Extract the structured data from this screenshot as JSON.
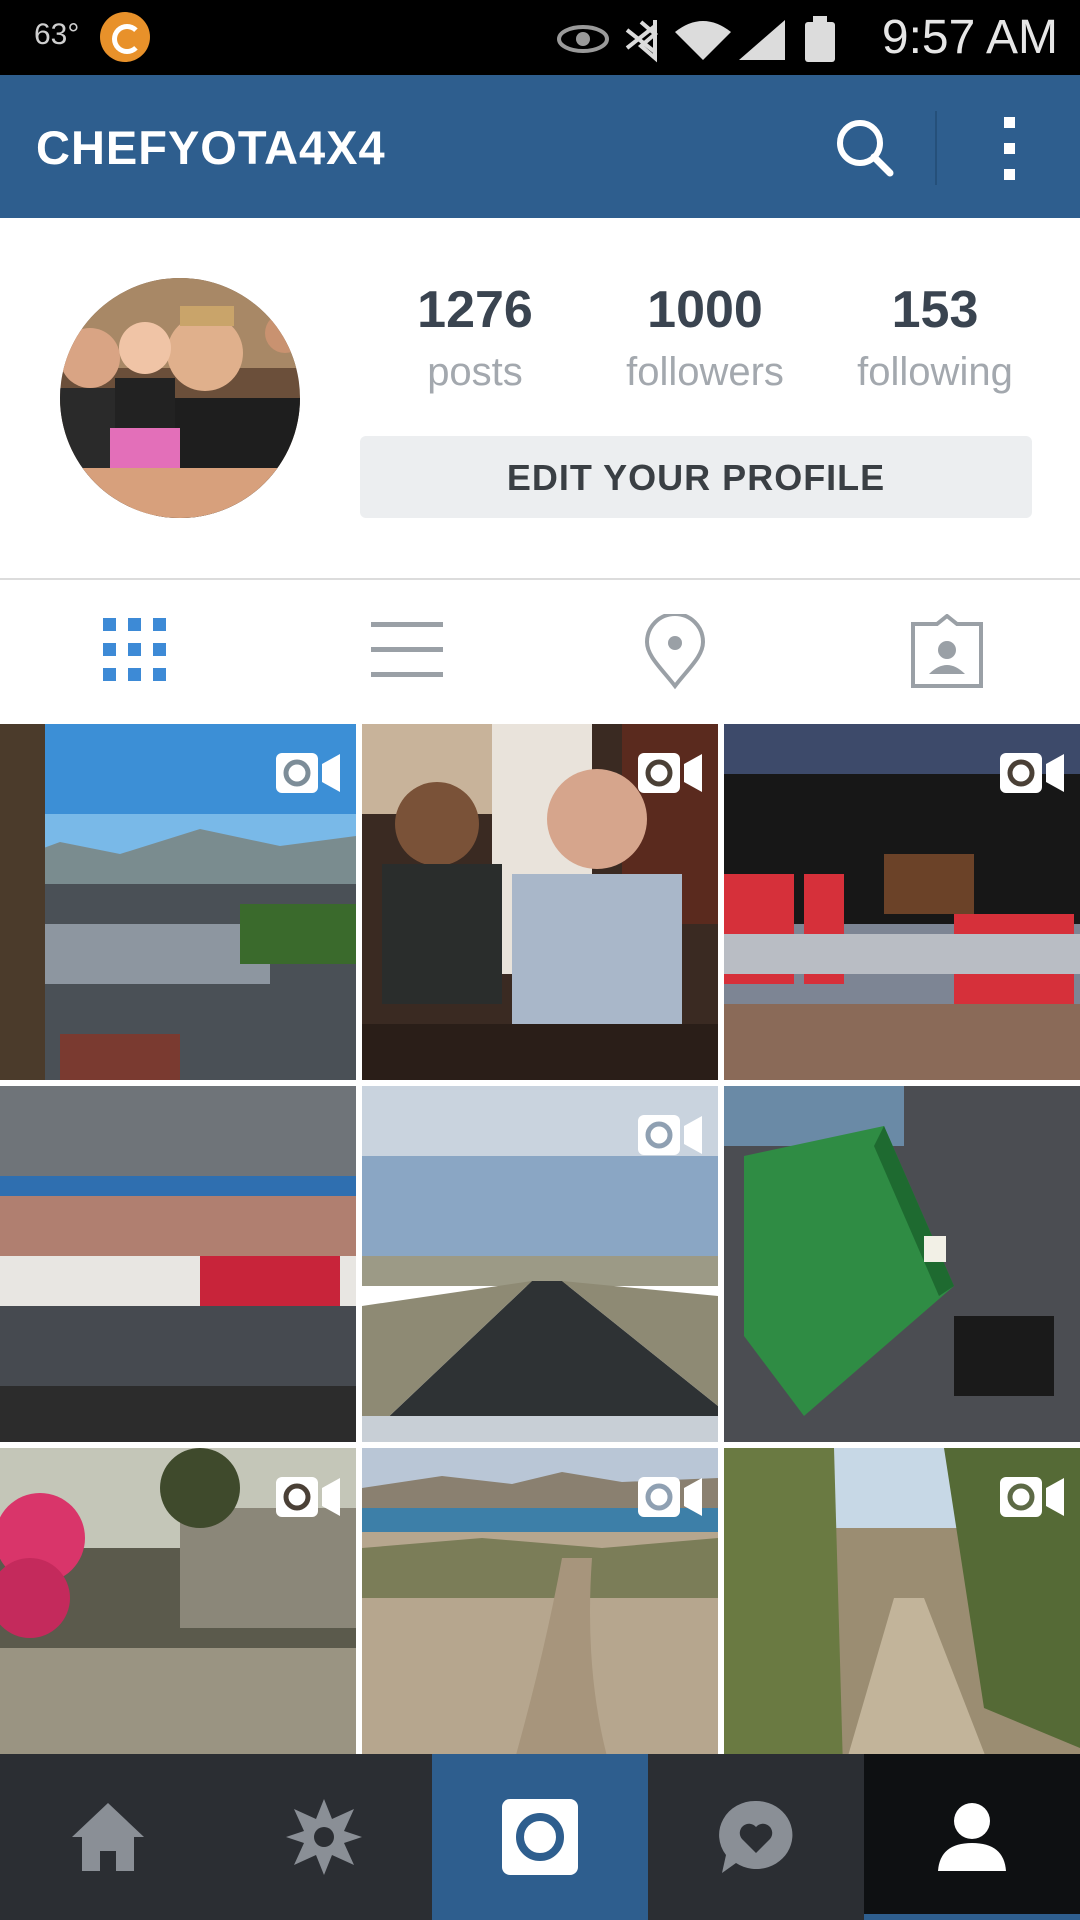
{
  "status_bar": {
    "temperature": "63°",
    "time": "9:57 AM",
    "icons": [
      "weather-icon",
      "app-notification-icon",
      "eye-icon",
      "bluetooth-icon",
      "wifi-icon",
      "signal-icon",
      "battery-icon"
    ]
  },
  "app_bar": {
    "username": "CHEFYOTA4X4",
    "icons": [
      "search-icon",
      "more-vert-icon"
    ]
  },
  "profile": {
    "stats": [
      {
        "value": "1276",
        "label": "posts"
      },
      {
        "value": "1000",
        "label": "followers"
      },
      {
        "value": "153",
        "label": "following"
      }
    ],
    "edit_button": "EDIT YOUR PROFILE"
  },
  "view_tabs": [
    {
      "name": "grid-view",
      "icon": "grid-icon",
      "active": true
    },
    {
      "name": "list-view",
      "icon": "list-icon",
      "active": false
    },
    {
      "name": "places",
      "icon": "location-pin-icon",
      "active": false
    },
    {
      "name": "photos-of-you",
      "icon": "tagged-person-icon",
      "active": false
    }
  ],
  "posts": [
    {
      "scene": "parking lot with palm trees and mountains",
      "is_video": true
    },
    {
      "scene": "two men talking at a table",
      "is_video": true
    },
    {
      "scene": "graduation ceremony on stage",
      "is_video": true
    },
    {
      "scene": "graduation arena with seated crowd",
      "is_video": false
    },
    {
      "scene": "desert highway",
      "is_video": true
    },
    {
      "scene": "green metal box in truck bed",
      "is_video": false
    },
    {
      "scene": "pink flowers and rocks",
      "is_video": true
    },
    {
      "scene": "dirt trail near lake",
      "is_video": true
    },
    {
      "scene": "desert dirt path with bushes",
      "is_video": true
    }
  ],
  "bottom_nav": [
    {
      "name": "home",
      "icon": "home-icon",
      "active": false
    },
    {
      "name": "explore",
      "icon": "explore-star-icon",
      "active": false
    },
    {
      "name": "camera",
      "icon": "camera-icon",
      "active": false
    },
    {
      "name": "activity",
      "icon": "heart-bubble-icon",
      "active": false
    },
    {
      "name": "profile",
      "icon": "profile-icon",
      "active": true
    }
  ],
  "colors": {
    "header_blue": "#2e5e8e",
    "tab_active_blue": "#3d8ad6",
    "nav_dark": "#2b2e33",
    "nav_active": "#0e1012"
  }
}
